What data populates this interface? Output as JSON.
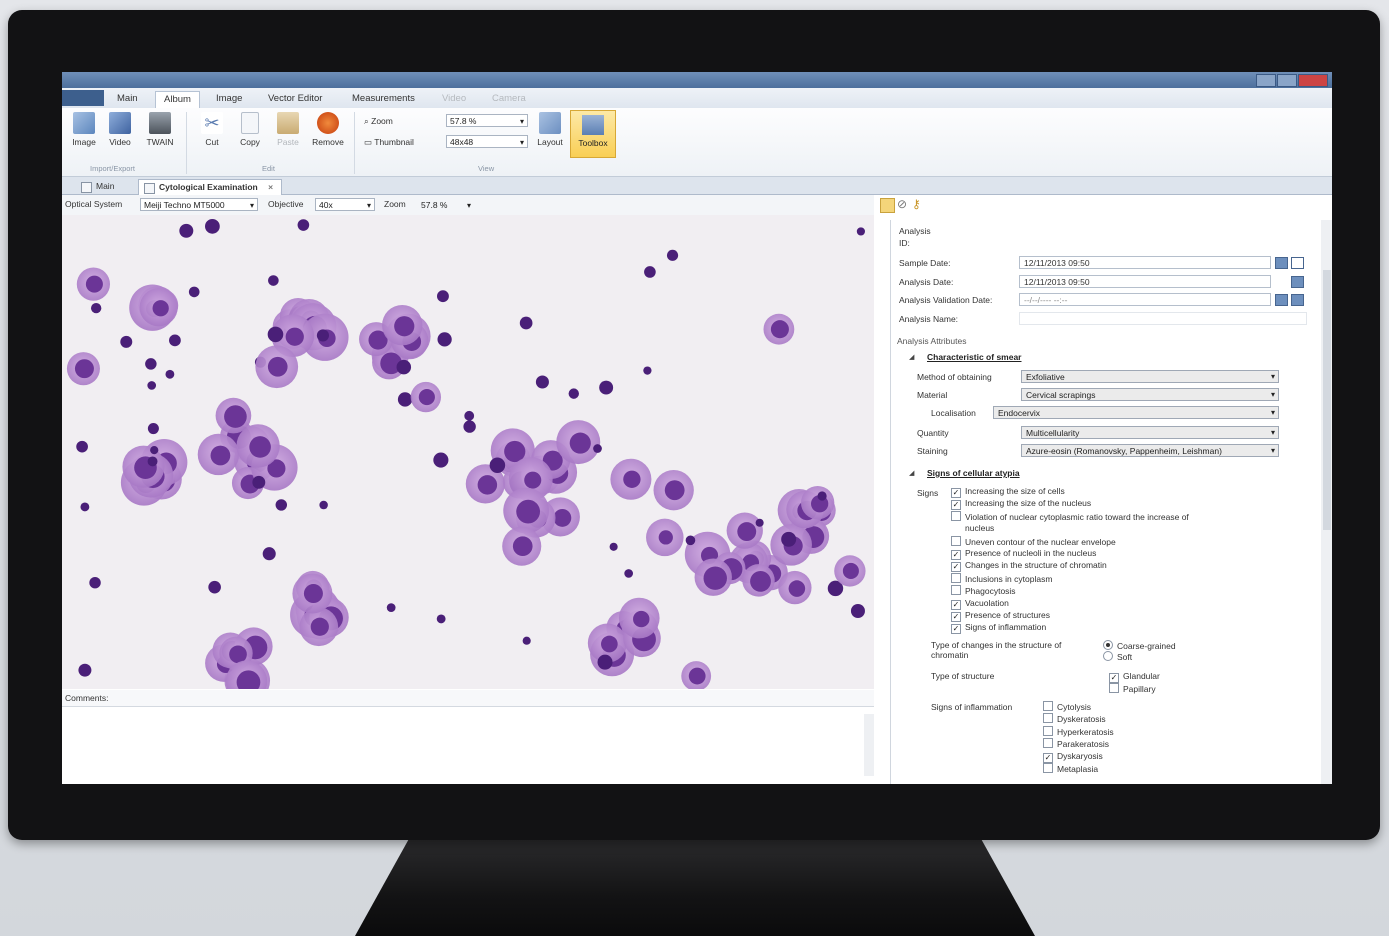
{
  "ribbon": {
    "tabs": [
      {
        "label": "Main",
        "active": false,
        "dim": false
      },
      {
        "label": "Album",
        "active": true,
        "dim": false
      },
      {
        "label": "Image",
        "active": false,
        "dim": false
      },
      {
        "label": "Vector Editor",
        "active": false,
        "dim": false
      },
      {
        "label": "Measurements",
        "active": false,
        "dim": false
      },
      {
        "label": "Video",
        "active": false,
        "dim": true
      },
      {
        "label": "Camera",
        "active": false,
        "dim": true
      }
    ],
    "buttons": {
      "image": "Image",
      "video": "Video",
      "twain": "TWAIN",
      "cut": "Cut",
      "copy": "Copy",
      "paste": "Paste",
      "remove": "Remove",
      "layout": "Layout",
      "toolbox": "Toolbox"
    },
    "groups": {
      "import_export": "Import/Export",
      "edit": "Edit",
      "view": "View"
    },
    "zoom_label": "Zoom",
    "zoom_value": "57.8 %",
    "thumbnail_label": "Thumbnail",
    "thumbnail_value": "48x48"
  },
  "doc_tabs": {
    "main": "Main",
    "active": "Cytological Examination",
    "close": "×"
  },
  "image_toolbar": {
    "optical_label": "Optical System",
    "optical_value": "Meiji Techno MT5000",
    "objective_label": "Objective",
    "objective_value": "40x",
    "zoom_label": "Zoom",
    "zoom_value": "57.8 %"
  },
  "comments_label": "Comments:",
  "analysis": {
    "heading": "Analysis",
    "id_label": "ID:",
    "sample_date_label": "Sample Date:",
    "sample_date": "12/11/2013 09:50",
    "analysis_date_label": "Analysis Date:",
    "analysis_date": "12/11/2013 09:50",
    "validation_label": "Analysis Validation Date:",
    "validation_date": "--/--/---- --:--",
    "name_label": "Analysis Name:",
    "attributes_heading": "Analysis Attributes",
    "smear_section": "Characteristic of smear",
    "method_label": "Method of obtaining",
    "method_value": "Exfoliative",
    "material_label": "Material",
    "material_value": "Cervical scrapings",
    "localisation_label": "Localisation",
    "localisation_value": "Endocervix",
    "quantity_label": "Quantity",
    "quantity_value": "Multicellularity",
    "staining_label": "Staining",
    "staining_value": "Azure-eosin (Romanovsky, Pappenheim, Leishman)",
    "atypia_section": "Signs of cellular atypia",
    "signs_label": "Signs",
    "signs": [
      {
        "text": "Increasing the size of cells",
        "checked": true
      },
      {
        "text": "Increasing the size of the nucleus",
        "checked": true
      },
      {
        "text": "Violation of nuclear cytoplasmic ratio toward the increase of",
        "checked": false
      },
      {
        "text": "Uneven contour of the nuclear envelope",
        "checked": false
      },
      {
        "text": "Presence of nucleoli in the nucleus",
        "checked": true
      },
      {
        "text": "Changes in the structure of chromatin",
        "checked": true
      },
      {
        "text": "Inclusions in cytoplasm",
        "checked": false
      },
      {
        "text": "Phagocytosis",
        "checked": false
      },
      {
        "text": "Vacuolation",
        "checked": true
      },
      {
        "text": "Presence of structures",
        "checked": true
      },
      {
        "text": "Signs of inflammation",
        "checked": true
      }
    ],
    "signs_wrap": "nucleus",
    "chromatin_label_1": "Type of changes in the structure of",
    "chromatin_label_2": "chromatin",
    "chromatin_options": [
      {
        "text": "Coarse-grained",
        "selected": true
      },
      {
        "text": "Soft",
        "selected": false
      }
    ],
    "structure_label": "Type of structure",
    "structure_options": [
      {
        "text": "Glandular",
        "checked": true
      },
      {
        "text": "Papillary",
        "checked": false
      }
    ],
    "inflammation_label": "Signs of inflammation",
    "inflammation_options": [
      {
        "text": "Cytolysis",
        "checked": false
      },
      {
        "text": "Dyskeratosis",
        "checked": false
      },
      {
        "text": "Hyperkeratosis",
        "checked": false
      },
      {
        "text": "Parakeratosis",
        "checked": false
      },
      {
        "text": "Dyskaryosis",
        "checked": true
      },
      {
        "text": "Metaplasia",
        "checked": false
      }
    ]
  },
  "colors": {
    "accent": "#f9cf55",
    "stain_cytoplasm": "#b98fd0",
    "stain_nucleus": "#5a2b8c"
  }
}
